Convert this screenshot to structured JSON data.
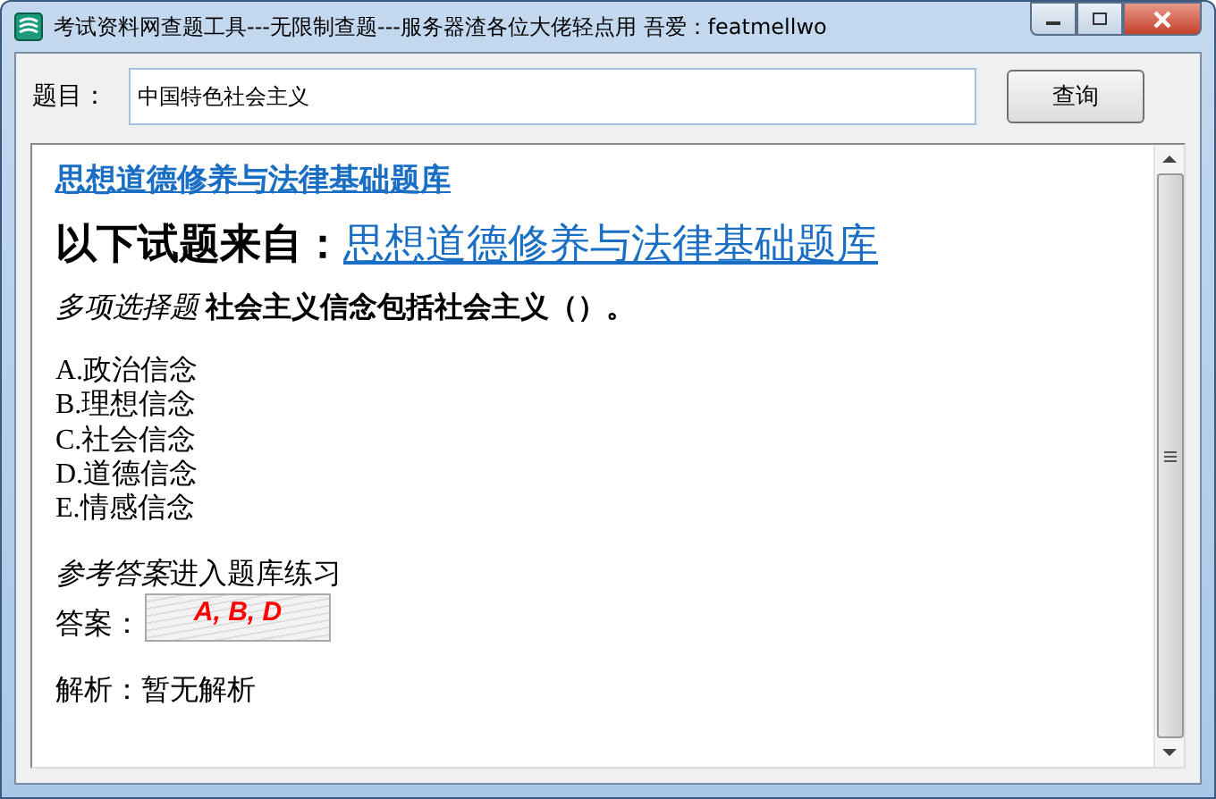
{
  "window": {
    "title": "考试资料网查题工具---无限制查题---服务器渣各位大佬轻点用   吾爱：featmellwo"
  },
  "search": {
    "label": "题目：",
    "value": "中国特色社会主义",
    "button": "查询"
  },
  "result": {
    "bank_link": "思想道德修养与法律基础题库",
    "source_prefix": "以下试题来自：",
    "source_link": "思想道德修养与法律基础题库",
    "question_type": "多项选择题",
    "question": "社会主义信念包括社会主义（）。",
    "options": [
      {
        "letter": "A.",
        "text": "政治信念"
      },
      {
        "letter": "B.",
        "text": "理想信念"
      },
      {
        "letter": "C.",
        "text": "社会信念"
      },
      {
        "letter": "D.",
        "text": "道德信念"
      },
      {
        "letter": "E.",
        "text": "情感信念"
      }
    ],
    "reference_label": "参考答案",
    "practice_text": "进入题库练习",
    "answer_label": "答案：",
    "answer_value": "A, B, D",
    "analysis": "解析：暂无解析"
  }
}
